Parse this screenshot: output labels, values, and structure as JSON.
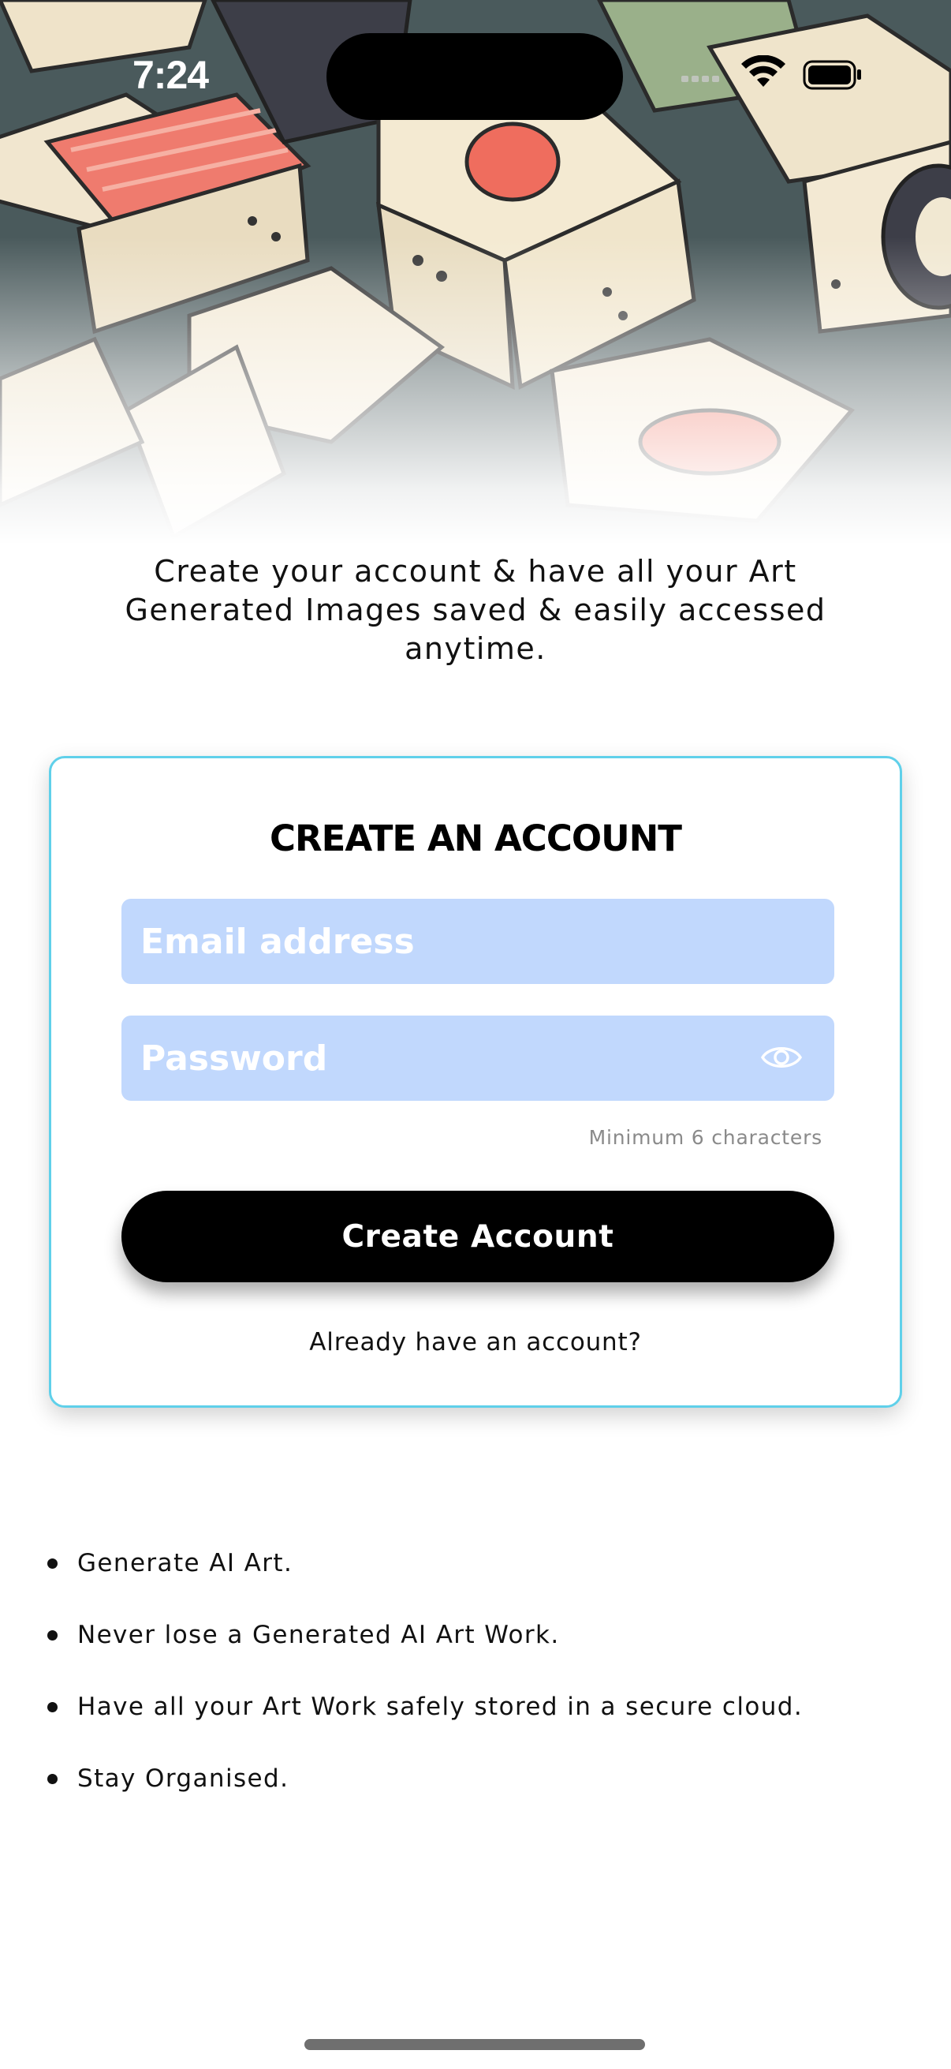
{
  "status_bar": {
    "time": "7:24"
  },
  "intro": {
    "text": "Create your account & have all your Art Generated Images saved & easily accessed anytime."
  },
  "form": {
    "title": "CREATE AN ACCOUNT",
    "email": {
      "placeholder": "Email address",
      "value": ""
    },
    "password": {
      "placeholder": "Password",
      "value": ""
    },
    "password_hint": "Minimum 6 characters",
    "submit_label": "Create Account",
    "signin_link": "Already have an account?"
  },
  "features": [
    {
      "text": "Generate AI Art."
    },
    {
      "text": "Never lose a Generated AI Art Work."
    },
    {
      "text": "Have all your Art Work safely stored in a secure cloud."
    },
    {
      "text": "Stay Organised."
    }
  ],
  "icons": {
    "status": [
      "wifi-icon",
      "battery-icon"
    ],
    "password_toggle": "eye-icon"
  },
  "colors": {
    "card_border": "#5fd0ea",
    "input_fill": "#c1d8fd",
    "button_fill": "#000000"
  }
}
